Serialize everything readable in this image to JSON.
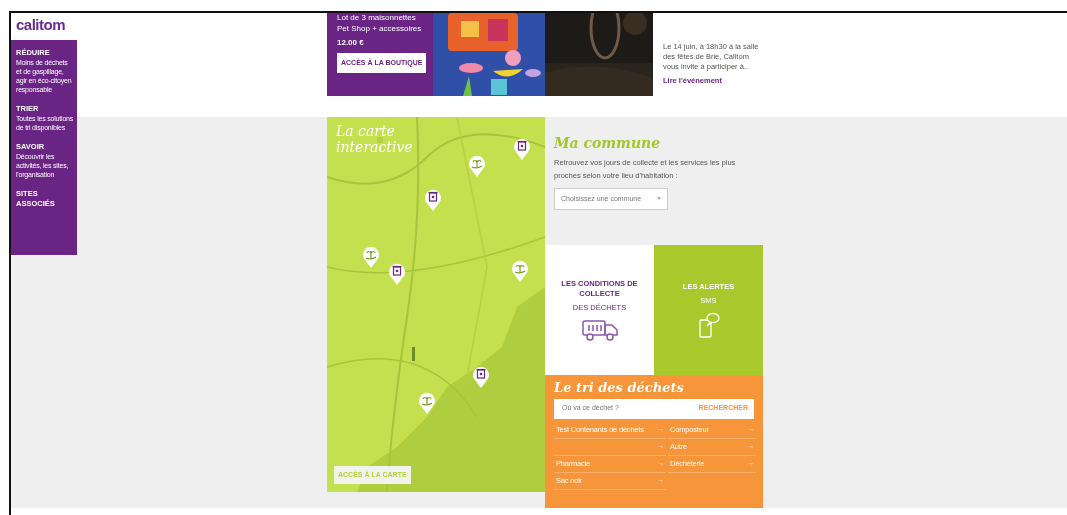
{
  "logo": {
    "text": "calitom"
  },
  "sidebar": {
    "items": [
      {
        "title": "RÉDUIRE",
        "description": "Moins de déchets et de gaspillage, agir en éco-citoyen responsable"
      },
      {
        "title": "TRIER",
        "description": "Toutes les solutions de tri disponibles"
      },
      {
        "title": "SAVOIR",
        "description": "Découvrir les activités, les sites, l'organisation"
      },
      {
        "title": "SITES ASSOCIÉS"
      }
    ]
  },
  "shop": {
    "product": "Lot de 3 maisonnettes Pet Shop + accessoires",
    "price": "12.00 €",
    "button": "ACCÈS À LA BOUTIQUE"
  },
  "event": {
    "text": "Le 14 juin, à 18h30 à la salle des fêtes de Brie, Calitom vous invite à participer à..",
    "link": "Lire l'événement"
  },
  "map": {
    "title": "La carte interactive",
    "button": "ACCÈS À LA CARTE"
  },
  "commune": {
    "title": "Ma commune",
    "text": "Retrouvez vos jours de collecte et les services les plus proches selon votre lieu d'habitation :",
    "select": "Choisissez une commune"
  },
  "tiles": [
    {
      "kind": "collecte",
      "title": "LES CONDITIONS DE COLLECTE",
      "subtitle": "DES DÉCHETS"
    },
    {
      "kind": "alertes",
      "title": "LES ALERTES",
      "subtitle": "SMS"
    }
  ],
  "sorting": {
    "title": "Le tri des déchets",
    "placeholder": "Où va ce déchet ?",
    "button": "RECHERCHER",
    "links": [
      {
        "label": "Test Contenants de déchets",
        "arrow": "→"
      },
      {
        "label": "Composteur",
        "arrow": "→"
      },
      {
        "arrow": "→"
      },
      {
        "label": "Autre",
        "arrow": "→"
      },
      {
        "label": "Pharmacie",
        "arrow": "→"
      },
      {
        "label": "Déchèterie",
        "arrow": "→"
      },
      {
        "label": "Sac noir",
        "arrow": "→"
      }
    ]
  }
}
